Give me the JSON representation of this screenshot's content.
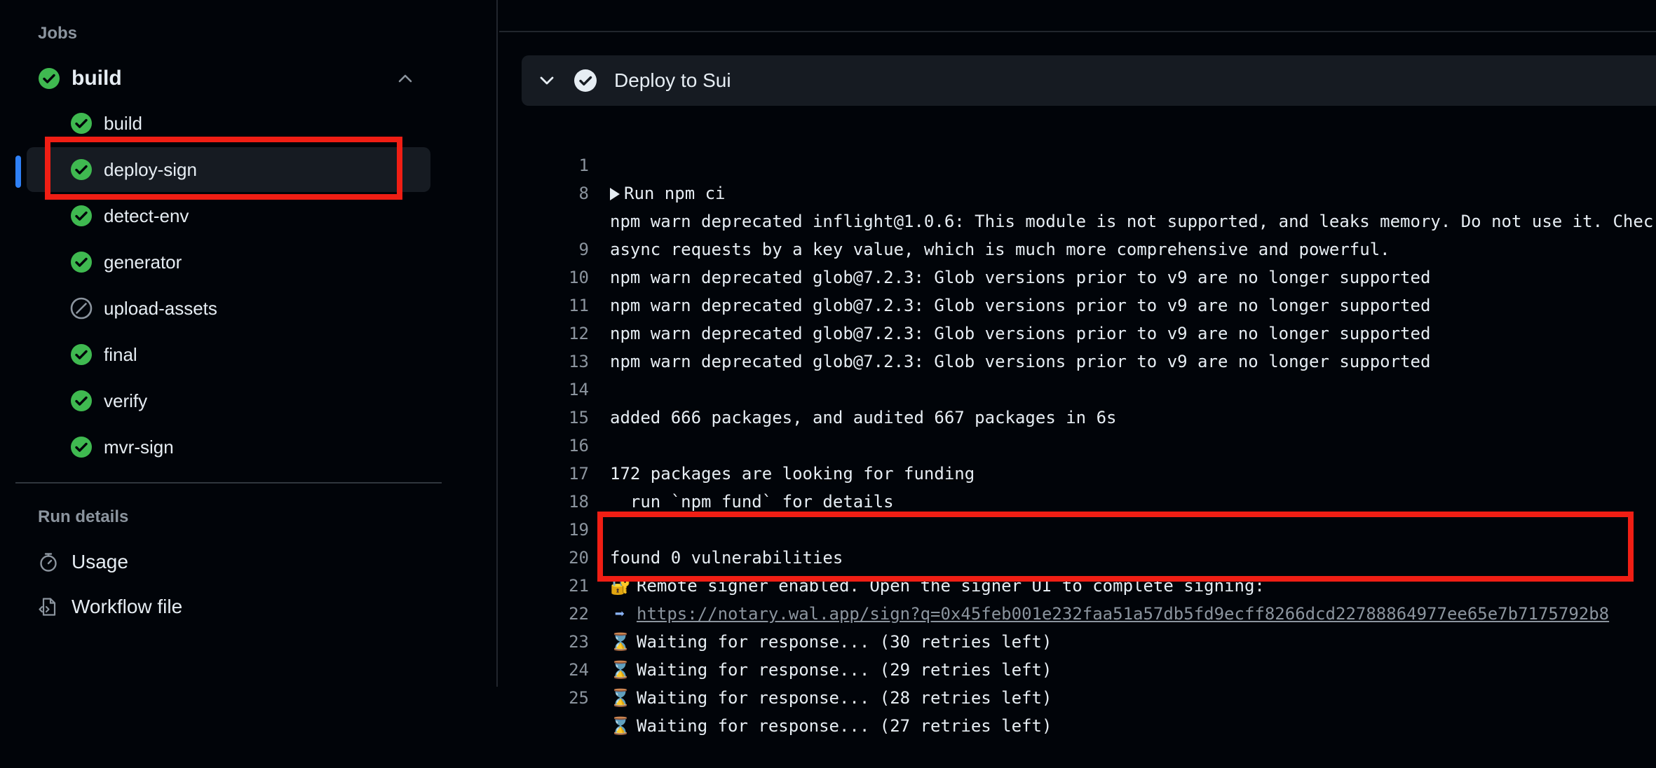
{
  "sidebar": {
    "jobs_label": "Jobs",
    "group": {
      "name": "build",
      "status": "success"
    },
    "jobs": [
      {
        "label": "build",
        "status": "success"
      },
      {
        "label": "deploy-sign",
        "status": "success",
        "selected": true
      },
      {
        "label": "detect-env",
        "status": "success"
      },
      {
        "label": "generator",
        "status": "success"
      },
      {
        "label": "upload-assets",
        "status": "skipped"
      },
      {
        "label": "final",
        "status": "success"
      },
      {
        "label": "verify",
        "status": "success"
      },
      {
        "label": "mvr-sign",
        "status": "success"
      }
    ],
    "run_details_label": "Run details",
    "details": [
      {
        "label": "Usage",
        "icon": "stopwatch-icon"
      },
      {
        "label": "Workflow file",
        "icon": "file-code-icon"
      }
    ]
  },
  "step": {
    "title": "Deploy to Sui",
    "status": "success"
  },
  "log": [
    {
      "num": "1",
      "text": "Run npm ci"
    },
    {
      "num": "8",
      "text": "npm warn deprecated inflight@1.0.6: This module is not supported, and leaks memory. Do not use it. Chec"
    },
    {
      "num": "",
      "text": "async requests by a key value, which is much more comprehensive and powerful."
    },
    {
      "num": "9",
      "text": "npm warn deprecated glob@7.2.3: Glob versions prior to v9 are no longer supported"
    },
    {
      "num": "10",
      "text": "npm warn deprecated glob@7.2.3: Glob versions prior to v9 are no longer supported"
    },
    {
      "num": "11",
      "text": "npm warn deprecated glob@7.2.3: Glob versions prior to v9 are no longer supported"
    },
    {
      "num": "12",
      "text": "npm warn deprecated glob@7.2.3: Glob versions prior to v9 are no longer supported"
    },
    {
      "num": "13",
      "text": ""
    },
    {
      "num": "14",
      "text": "added 666 packages, and audited 667 packages in 6s"
    },
    {
      "num": "15",
      "text": ""
    },
    {
      "num": "16",
      "text": "172 packages are looking for funding"
    },
    {
      "num": "17",
      "text": "  run `npm fund` for details"
    },
    {
      "num": "18",
      "text": ""
    },
    {
      "num": "19",
      "text": "found 0 vulnerabilities"
    },
    {
      "num": "20",
      "emoji": "🔐",
      "text": "Remote signer enabled. Open the signer UI to complete signing:"
    },
    {
      "num": "21",
      "emoji": "➡",
      "link": "https://notary.wal.app/sign?q=0x45feb001e232faa51a57db5fd9ecff8266dcd22788864977ee65e7b7175792b8"
    },
    {
      "num": "22",
      "emoji": "⌛",
      "text": "Waiting for response... (30 retries left)"
    },
    {
      "num": "23",
      "emoji": "⌛",
      "text": "Waiting for response... (29 retries left)"
    },
    {
      "num": "24",
      "emoji": "⌛",
      "text": "Waiting for response... (28 retries left)"
    },
    {
      "num": "25",
      "emoji": "⌛",
      "text": "Waiting for response... (27 retries left)"
    }
  ],
  "colors": {
    "success": "#3fb950",
    "highlight": "#f01e14",
    "selection": "#2f81f7"
  }
}
